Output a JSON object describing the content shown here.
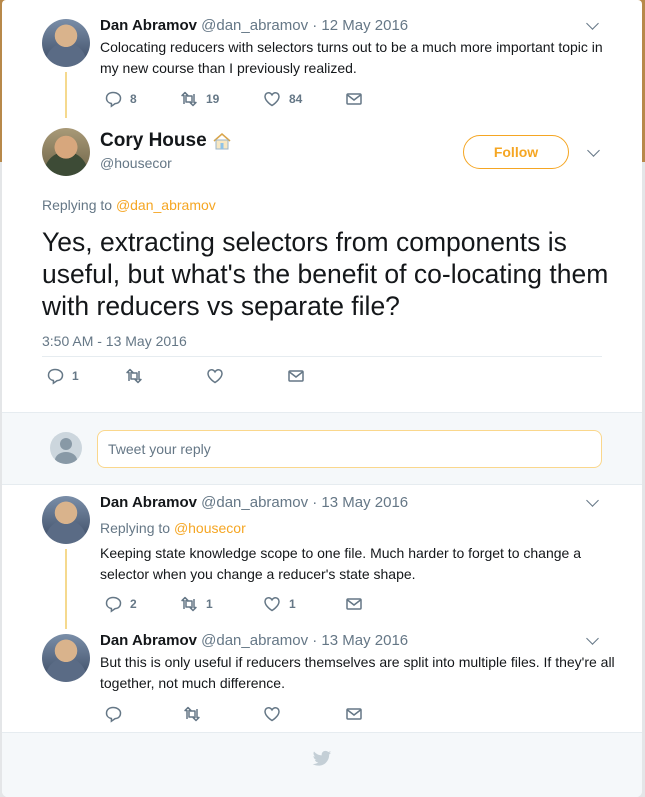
{
  "ancestor_tweet": {
    "name": "Dan Abramov",
    "handle_date": "@dan_abramov · 12 May 2016",
    "text": "Colocating reducers with selectors turns out to be a much more important topic in my new course than I previously realized.",
    "reply_count": "8",
    "retweet_count": "19",
    "like_count": "84"
  },
  "focus_tweet": {
    "name": "Cory House",
    "handle": "@housecor",
    "follow_label": "Follow",
    "replying_prefix": "Replying to",
    "replying_to": "@dan_abramov",
    "text": "Yes, extracting selectors from components is useful, but what's the benefit of co-locating them with reducers vs separate file?",
    "timestamp": "3:50 AM - 13 May 2016",
    "reply_count": "1"
  },
  "reply_box": {
    "placeholder": "Tweet your reply"
  },
  "replies": [
    {
      "name": "Dan Abramov",
      "handle_date": "@dan_abramov · 13 May 2016",
      "replying_prefix": "Replying to",
      "replying_to": "@housecor",
      "text": "Keeping state knowledge scope to one file. Much harder to forget to change a selector when you change a reducer's state shape.",
      "reply_count": "2",
      "retweet_count": "1",
      "like_count": "1"
    },
    {
      "name": "Dan Abramov",
      "handle_date": "@dan_abramov · 13 May 2016",
      "text": "But this is only useful if reducers themselves are split into multiple files. If they're all together, not much difference."
    }
  ],
  "colors": {
    "accent": "#f5a623",
    "thread_line": "#f5d98e",
    "meta_text": "#657786"
  }
}
